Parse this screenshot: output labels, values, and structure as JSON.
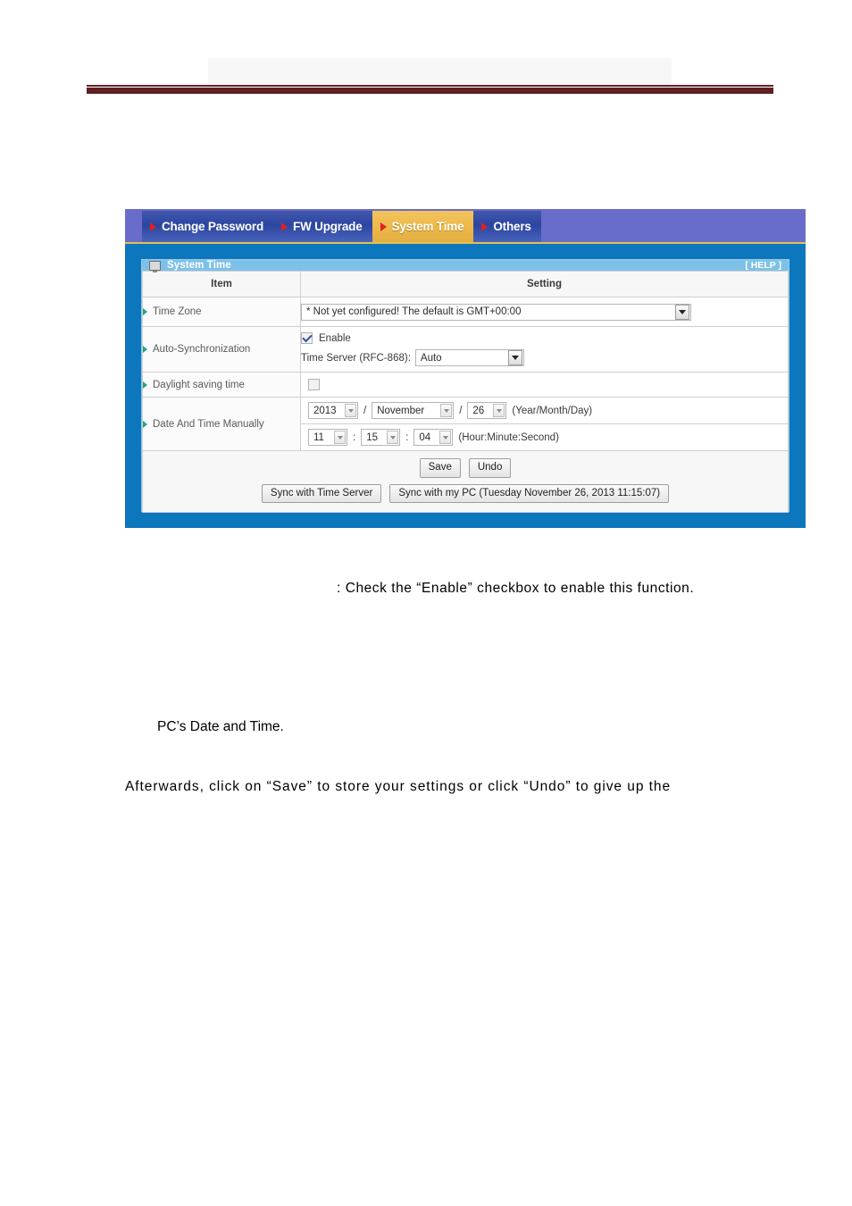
{
  "document_header": {
    "banner_placeholder": "",
    "rule_color": "#5f2024"
  },
  "router_ui": {
    "tabs": [
      {
        "label": "Change Password",
        "active": false
      },
      {
        "label": "FW Upgrade",
        "active": false
      },
      {
        "label": "System Time",
        "active": true
      },
      {
        "label": "Others",
        "active": false
      }
    ],
    "panel": {
      "icon": "monitor-icon",
      "title": "System Time",
      "help_label": "[ HELP ]",
      "accent_frame_color": "#0d77bd",
      "header_color": "#7dc1e8",
      "active_tab_color": "#eeb94a"
    },
    "table": {
      "headers": {
        "item": "Item",
        "setting": "Setting"
      },
      "rows": {
        "time_zone": {
          "label": "Time Zone",
          "value": "* Not yet configured! The default is GMT+00:00"
        },
        "auto_sync": {
          "label": "Auto-Synchronization",
          "enable_label": "Enable",
          "enable_checked": true,
          "time_server_label": "Time Server (RFC-868):",
          "time_server_value": "Auto"
        },
        "daylight": {
          "label": "Daylight saving time",
          "enable_checked": false
        },
        "manual": {
          "label": "Date And Time Manually",
          "year": "2013",
          "month": "November",
          "day": "26",
          "date_format_hint": "(Year/Month/Day)",
          "hour": "11",
          "minute": "15",
          "second": "04",
          "time_format_hint": "(Hour:Minute:Second)",
          "date_sep": "/",
          "time_sep": ":"
        }
      }
    },
    "buttons": {
      "save": "Save",
      "undo": "Undo",
      "sync_time_server": "Sync with Time Server",
      "sync_my_pc": "Sync with my PC (Tuesday November 26, 2013 11:15:07)"
    }
  },
  "body_text": {
    "line1": ": Check the “Enable” checkbox to enable this function.",
    "line2": "PC’s Date and Time.",
    "line3": "Afterwards, click on “Save” to store your settings or click “Undo” to give up the"
  }
}
